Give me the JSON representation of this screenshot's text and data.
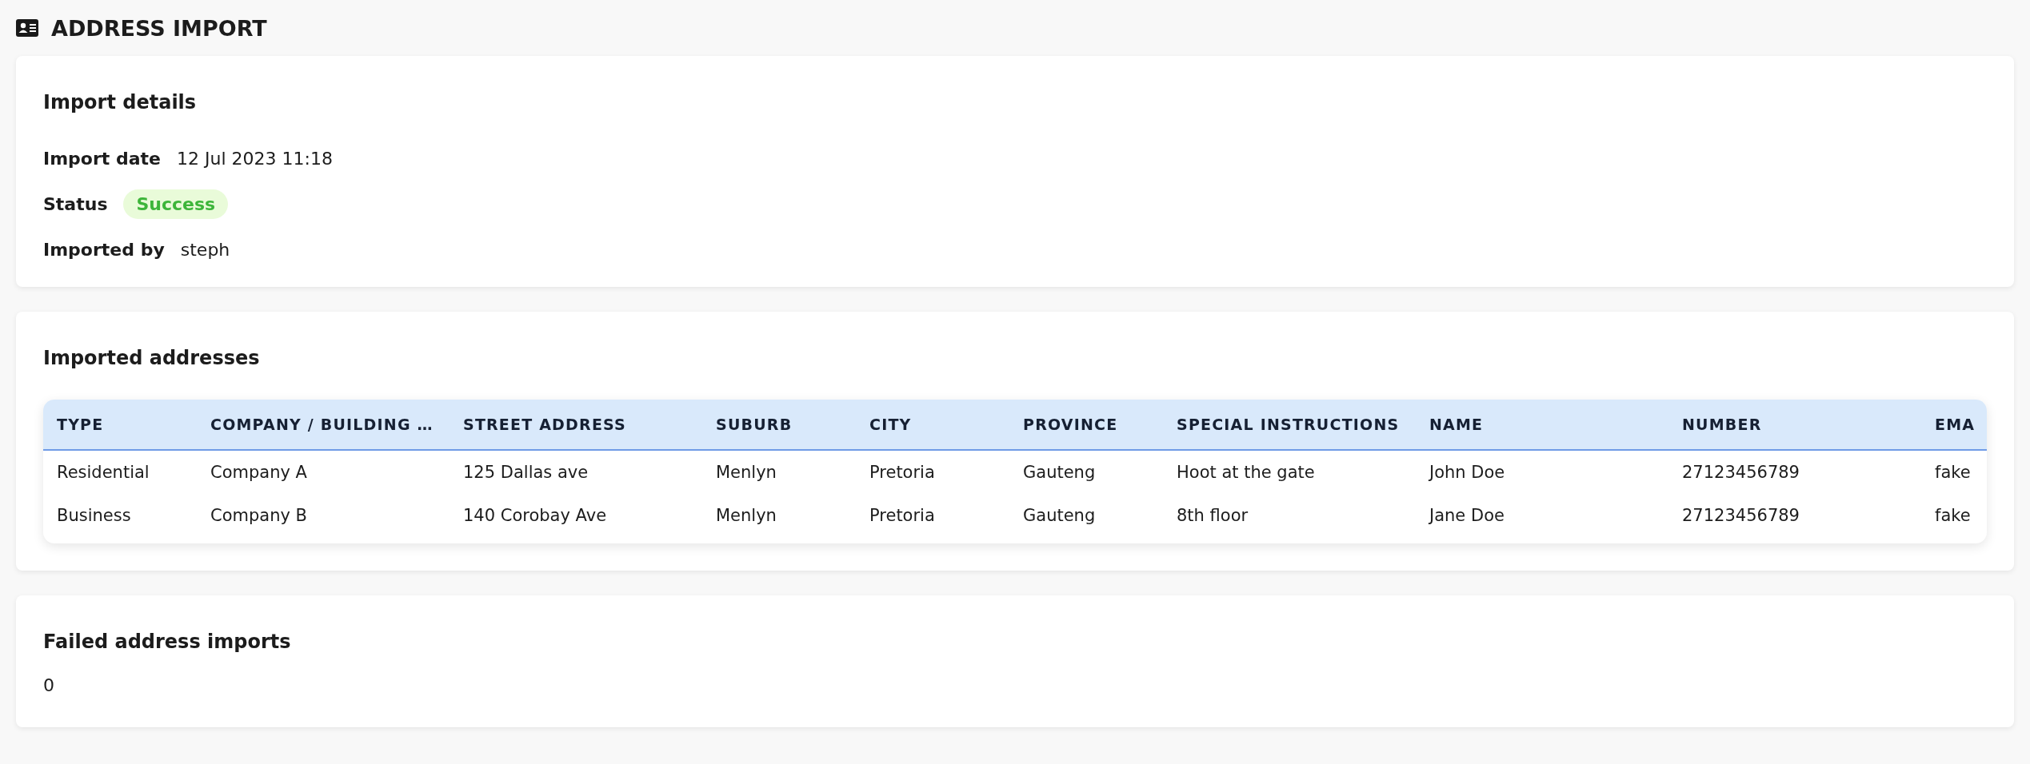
{
  "page": {
    "title": "ADDRESS IMPORT"
  },
  "import_details": {
    "heading": "Import details",
    "fields": [
      {
        "kind": "text",
        "label": "Import date",
        "value": "12 Jul 2023 11:18"
      },
      {
        "kind": "badge",
        "label": "Status",
        "value": "Success"
      },
      {
        "kind": "text",
        "label": "Imported by",
        "value": "steph"
      }
    ]
  },
  "imported_addresses": {
    "heading": "Imported addresses",
    "table": {
      "columns": [
        "TYPE",
        "COMPANY / BUILDING …",
        "STREET ADDRESS",
        "SUBURB",
        "CITY",
        "PROVINCE",
        "SPECIAL INSTRUCTIONS",
        "NAME",
        "NUMBER",
        "EMA"
      ],
      "rows": [
        [
          "Residential",
          "Company A",
          "125 Dallas ave",
          "Menlyn",
          "Pretoria",
          "Gauteng",
          "Hoot at the gate",
          "John Doe",
          "27123456789",
          "fake"
        ],
        [
          "Business",
          "Company B",
          "140 Corobay Ave",
          "Menlyn",
          "Pretoria",
          "Gauteng",
          "8th floor",
          "Jane Doe",
          "27123456789",
          "fake"
        ]
      ]
    }
  },
  "failed_imports": {
    "heading": "Failed address imports",
    "count": "0"
  }
}
